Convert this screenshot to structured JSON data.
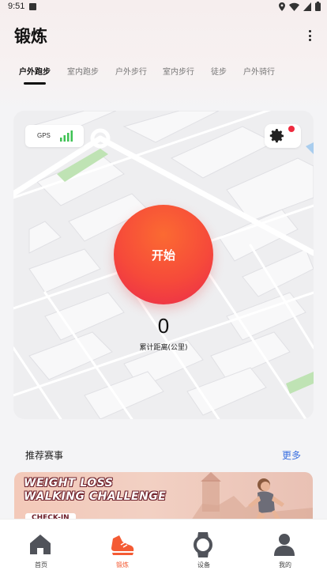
{
  "status_bar": {
    "time": "9:51"
  },
  "header": {
    "title": "锻炼"
  },
  "tabs": [
    {
      "label": "户外跑步",
      "active": true
    },
    {
      "label": "室内跑步",
      "active": false
    },
    {
      "label": "户外步行",
      "active": false
    },
    {
      "label": "室内步行",
      "active": false
    },
    {
      "label": "徒步",
      "active": false
    },
    {
      "label": "户外骑行",
      "active": false
    }
  ],
  "map": {
    "gps_label": "GPS",
    "gps_signal_bars": 4,
    "settings_has_notification": true
  },
  "workout": {
    "start_label": "开始",
    "distance_value": "0",
    "distance_label": "累计距离(公里)"
  },
  "recommended": {
    "title": "推荐赛事",
    "more_label": "更多",
    "banner": {
      "headline": "WEIGHT LOSS\nWALKING CHALLENGE",
      "cta": "CHECK-IN"
    }
  },
  "bottom_nav": [
    {
      "label": "首页",
      "icon": "home-icon",
      "active": false
    },
    {
      "label": "锻炼",
      "icon": "running-shoe-icon",
      "active": true
    },
    {
      "label": "设备",
      "icon": "watch-icon",
      "active": false
    },
    {
      "label": "我的",
      "icon": "profile-icon",
      "active": false
    }
  ],
  "colors": {
    "accent": "#f45b34",
    "start_gradient_top": "#fb6a32",
    "start_gradient_bottom": "#ea2a4b",
    "link": "#3a6fe0",
    "notification_dot": "#ee2a3e",
    "gps_signal": "#3ec253"
  }
}
